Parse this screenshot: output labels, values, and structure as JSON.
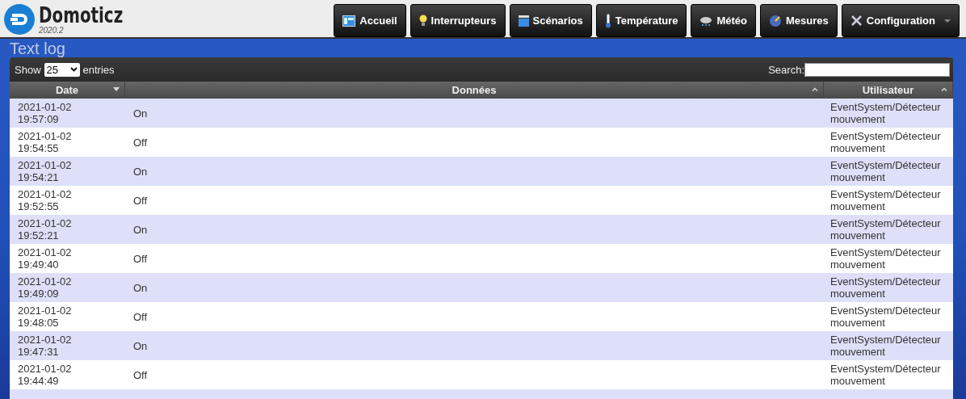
{
  "logo": {
    "name": "Domoticz",
    "version": "2020.2"
  },
  "nav": [
    {
      "label": "Accueil",
      "kind": "dashboard",
      "dropdown": false
    },
    {
      "label": "Interrupteurs",
      "kind": "bulb",
      "dropdown": false
    },
    {
      "label": "Scénarios",
      "kind": "clapper",
      "dropdown": false
    },
    {
      "label": "Température",
      "kind": "thermometer",
      "dropdown": false
    },
    {
      "label": "Météo",
      "kind": "cloud",
      "dropdown": false
    },
    {
      "label": "Mesures",
      "kind": "gauge",
      "dropdown": false
    },
    {
      "label": "Configuration",
      "kind": "tools",
      "dropdown": true
    }
  ],
  "page_title": "Text log",
  "length": {
    "before": "Show",
    "value": "25",
    "after": "entries"
  },
  "search": {
    "label": "Search:"
  },
  "table": {
    "columns": [
      {
        "label": "Date",
        "sorted_descending": true
      },
      {
        "label": "Données",
        "sorted_descending": false
      },
      {
        "label": "Utilisateur",
        "sorted_descending": false
      }
    ],
    "rows": [
      {
        "date": "2021-01-02",
        "time": "19:57:09",
        "data": "On",
        "user": "EventSystem/Détecteur mouvement"
      },
      {
        "date": "2021-01-02",
        "time": "19:54:55",
        "data": "Off",
        "user": "EventSystem/Détecteur mouvement"
      },
      {
        "date": "2021-01-02",
        "time": "19:54:21",
        "data": "On",
        "user": "EventSystem/Détecteur mouvement"
      },
      {
        "date": "2021-01-02",
        "time": "19:52:55",
        "data": "Off",
        "user": "EventSystem/Détecteur mouvement"
      },
      {
        "date": "2021-01-02",
        "time": "19:52:21",
        "data": "On",
        "user": "EventSystem/Détecteur mouvement"
      },
      {
        "date": "2021-01-02",
        "time": "19:49:40",
        "data": "Off",
        "user": "EventSystem/Détecteur mouvement"
      },
      {
        "date": "2021-01-02",
        "time": "19:49:09",
        "data": "On",
        "user": "EventSystem/Détecteur mouvement"
      },
      {
        "date": "2021-01-02",
        "time": "19:48:05",
        "data": "Off",
        "user": "EventSystem/Détecteur mouvement"
      },
      {
        "date": "2021-01-02",
        "time": "19:47:31",
        "data": "On",
        "user": "EventSystem/Détecteur mouvement"
      },
      {
        "date": "2021-01-02",
        "time": "19:44:49",
        "data": "Off",
        "user": "EventSystem/Détecteur mouvement"
      }
    ]
  }
}
